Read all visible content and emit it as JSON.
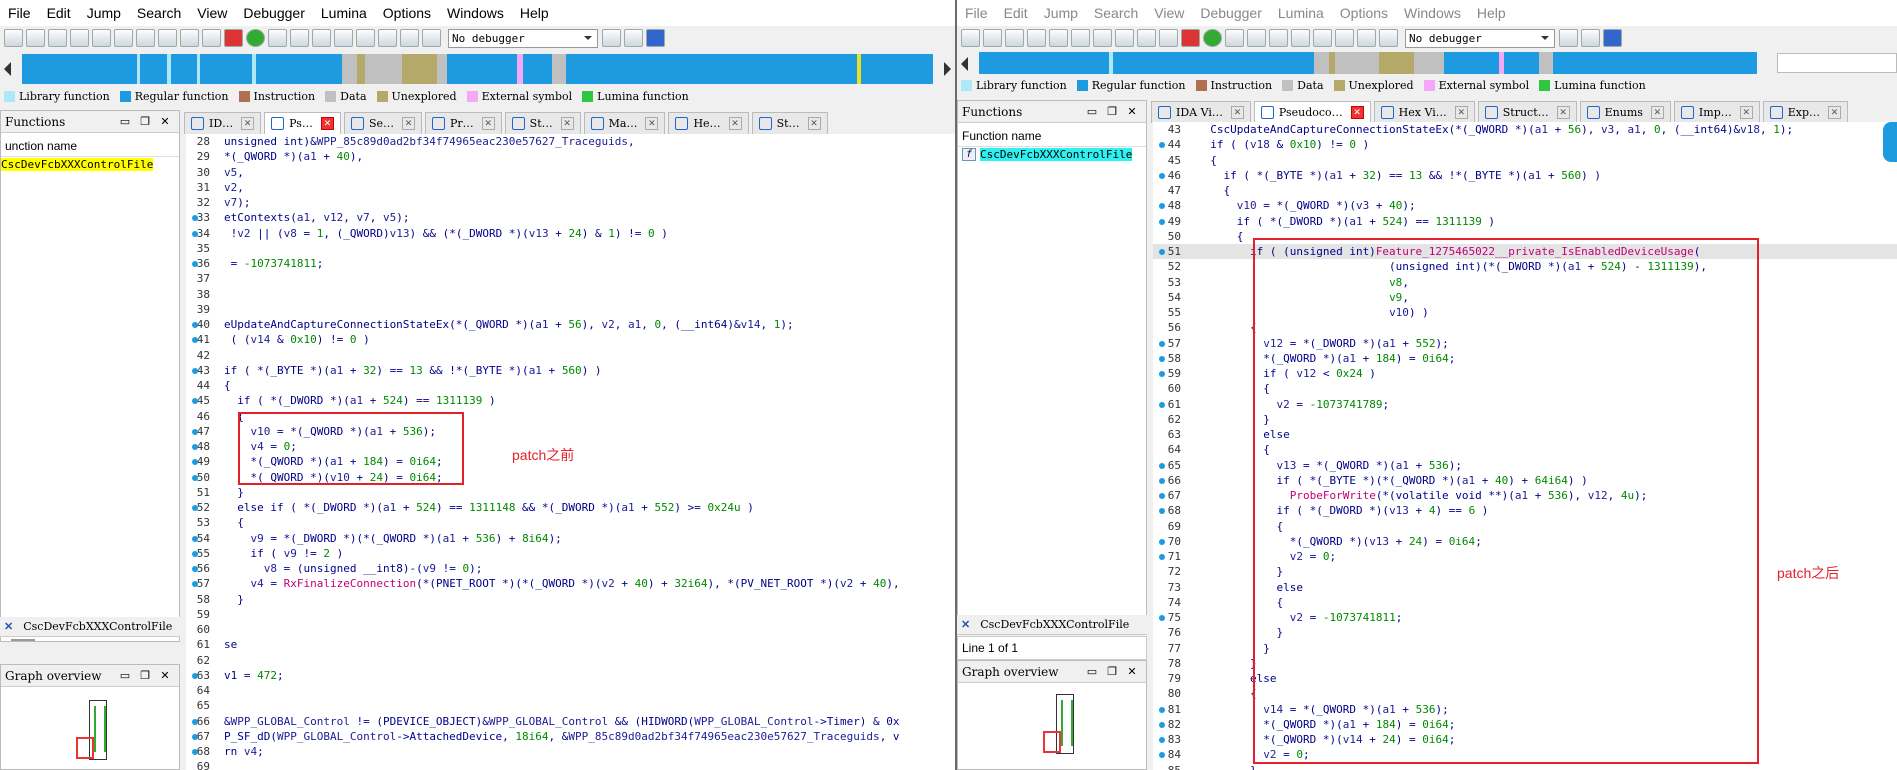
{
  "menu": [
    "File",
    "Edit",
    "Jump",
    "Search",
    "View",
    "Debugger",
    "Lumina",
    "Options",
    "Windows",
    "Help"
  ],
  "toolbar": {
    "debugger": "No debugger"
  },
  "legend": [
    {
      "label": "Library function",
      "color": "#aee8f6"
    },
    {
      "label": "Regular function",
      "color": "#1e9be0"
    },
    {
      "label": "Instruction",
      "color": "#b07050"
    },
    {
      "label": "Data",
      "color": "#c0c0c0"
    },
    {
      "label": "Unexplored",
      "color": "#b5a96a"
    },
    {
      "label": "External symbol",
      "color": "#f5a8f5"
    },
    {
      "label": "Lumina function",
      "color": "#2fc742"
    }
  ],
  "left": {
    "tabs": [
      "ID…",
      "Ps…",
      "Se…",
      "Pr…",
      "St…",
      "Ma…",
      "He…",
      "St…"
    ],
    "functions_panel": {
      "title": "Functions",
      "column": "unction name",
      "items": [
        "CscDevFcbXXXControlFile"
      ]
    },
    "file_tab": "CscDevFcbXXXControlFile",
    "graph_title": "Graph overview",
    "note": "patch之前",
    "lines": [
      {
        "n": "28",
        "d": false,
        "h": "unsigned int)&<span class=\"v\">WPP_85c89d0ad2bf34f74965eac230e57627_Traceguids</span>,"
      },
      {
        "n": "29",
        "d": false,
        "h": "*(_QWORD *)(<span class=\"v\">a1</span> + <span class=\"n\">40</span>),"
      },
      {
        "n": "30",
        "d": false,
        "h": "<span class=\"v\">v5</span>,"
      },
      {
        "n": "31",
        "d": false,
        "h": "<span class=\"v\">v2</span>,"
      },
      {
        "n": "32",
        "d": false,
        "h": "<span class=\"v\">v7</span>);"
      },
      {
        "n": "33",
        "d": true,
        "h": "etContexts(<span class=\"v\">a1</span>, <span class=\"v\">v12</span>, <span class=\"v\">v7</span>, <span class=\"v\">v5</span>);"
      },
      {
        "n": "34",
        "d": true,
        "h": " !<span class=\"v\">v2</span> || (<span class=\"v\">v8</span> = <span class=\"n\">1</span>, (_QWORD)<span class=\"v\">v13</span>) &amp;&amp; (*(_DWORD *)(<span class=\"v\">v13</span> + <span class=\"n\">24</span>) &amp; <span class=\"n\">1</span>) != <span class=\"n\">0</span> )"
      },
      {
        "n": "35",
        "d": false,
        "h": ""
      },
      {
        "n": "36",
        "d": true,
        "h": " = <span class=\"n\">-1073741811</span>;"
      },
      {
        "n": "37",
        "d": false,
        "h": ""
      },
      {
        "n": "38",
        "d": false,
        "h": ""
      },
      {
        "n": "39",
        "d": false,
        "h": ""
      },
      {
        "n": "40",
        "d": true,
        "h": "eUpdateAndCaptureConnectionStateEx(*(_QWORD *)(<span class=\"v\">a1</span> + <span class=\"n\">56</span>), <span class=\"v\">v2</span>, <span class=\"v\">a1</span>, <span class=\"n\">0</span>, (__int64)&amp;<span class=\"v\">v14</span>, <span class=\"n\">1</span>);"
      },
      {
        "n": "41",
        "d": true,
        "h": " ( (<span class=\"v\">v14</span> &amp; <span class=\"n\">0x10</span>) != <span class=\"n\">0</span> )"
      },
      {
        "n": "42",
        "d": false,
        "h": ""
      },
      {
        "n": "43",
        "d": true,
        "h": "if ( *(_BYTE *)(<span class=\"v\">a1</span> + <span class=\"n\">32</span>) == <span class=\"n\">13</span> &amp;&amp; !*(_BYTE *)(<span class=\"v\">a1</span> + <span class=\"n\">560</span>) )"
      },
      {
        "n": "44",
        "d": false,
        "h": "{"
      },
      {
        "n": "45",
        "d": true,
        "h": "  if ( *(_DWORD *)(<span class=\"v\">a1</span> + <span class=\"n\">524</span>) == <span class=\"n\">1311139</span> )"
      },
      {
        "n": "46",
        "d": false,
        "h": "  {"
      },
      {
        "n": "47",
        "d": true,
        "h": "    <span class=\"v\">v10</span> = *(_QWORD *)(<span class=\"v\">a1</span> + <span class=\"n\">536</span>);"
      },
      {
        "n": "48",
        "d": true,
        "h": "    <span class=\"v\">v4</span> = <span class=\"n\">0</span>;"
      },
      {
        "n": "49",
        "d": true,
        "h": "    *(_QWORD *)(<span class=\"v\">a1</span> + <span class=\"n\">184</span>) = <span class=\"n\">0i64</span>;"
      },
      {
        "n": "50",
        "d": true,
        "h": "    *(_QWORD *)(<span class=\"v\">v10</span> + <span class=\"n\">24</span>) = <span class=\"n\">0i64</span>;"
      },
      {
        "n": "51",
        "d": false,
        "h": "  }"
      },
      {
        "n": "52",
        "d": true,
        "h": "  else if ( *(_DWORD *)(<span class=\"v\">a1</span> + <span class=\"n\">524</span>) == <span class=\"n\">1311148</span> &amp;&amp; *(_DWORD *)(<span class=\"v\">a1</span> + <span class=\"n\">552</span>) &gt;= <span class=\"n\">0x24u</span> )"
      },
      {
        "n": "53",
        "d": false,
        "h": "  {"
      },
      {
        "n": "54",
        "d": true,
        "h": "    <span class=\"v\">v9</span> = *(_DWORD *)(*(_QWORD *)(<span class=\"v\">a1</span> + <span class=\"n\">536</span>) + <span class=\"n\">8i64</span>);"
      },
      {
        "n": "55",
        "d": true,
        "h": "    if ( <span class=\"v\">v9</span> != <span class=\"n\">2</span> )"
      },
      {
        "n": "56",
        "d": true,
        "h": "      <span class=\"v\">v8</span> = (unsigned __int8)-(<span class=\"v\">v9</span> != <span class=\"n\">0</span>);"
      },
      {
        "n": "57",
        "d": true,
        "h": "    <span class=\"v\">v4</span> = <span class=\"f\">RxFinalizeConnection</span>(*(PNET_ROOT *)(*(_QWORD *)(<span class=\"v\">v2</span> + <span class=\"n\">40</span>) + <span class=\"n\">32i64</span>), *(PV_NET_ROOT *)(<span class=\"v\">v2</span> + <span class=\"n\">40</span>),"
      },
      {
        "n": "58",
        "d": false,
        "h": "  }"
      },
      {
        "n": "59",
        "d": false,
        "h": ""
      },
      {
        "n": "60",
        "d": false,
        "h": ""
      },
      {
        "n": "61",
        "d": false,
        "h": "se"
      },
      {
        "n": "62",
        "d": false,
        "h": ""
      },
      {
        "n": "63",
        "d": true,
        "h": "v1 = <span class=\"n\">472</span>;"
      },
      {
        "n": "64",
        "d": false,
        "h": ""
      },
      {
        "n": "65",
        "d": false,
        "h": ""
      },
      {
        "n": "66",
        "d": true,
        "h": "&amp;<span class=\"v\">WPP_GLOBAL_Control</span> != (PDEVICE_OBJECT)&amp;<span class=\"v\">WPP_GLOBAL_Control</span> &amp;&amp; (HIDWORD(<span class=\"v\">WPP_GLOBAL_Control</span>-&gt;Timer) &amp; 0x"
      },
      {
        "n": "67",
        "d": true,
        "h": "P_SF_dD(<span class=\"v\">WPP_GLOBAL_Control</span>-&gt;AttachedDevice, <span class=\"n\">18i64</span>, &amp;<span class=\"v\">WPP_85c89d0ad2bf34f74965eac230e57627_Traceguids</span>, v"
      },
      {
        "n": "68",
        "d": true,
        "h": "rn <span class=\"v\">v4</span>;"
      },
      {
        "n": "69",
        "d": false,
        "h": ""
      }
    ]
  },
  "right": {
    "tabs": [
      "IDA Vi…",
      "Pseudoco…",
      "Hex Vi…",
      "Struct…",
      "Enums",
      "Imp…",
      "Exp…"
    ],
    "functions_panel": {
      "title": "Functions",
      "column": "Function name",
      "items": [
        "CscDevFcbXXXControlFile"
      ]
    },
    "file_tab": "CscDevFcbXXXControlFile",
    "line_status": "Line 1 of 1",
    "graph_title": "Graph overview",
    "note": "patch之后",
    "lines": [
      {
        "n": "43",
        "d": false,
        "h": "  CscUpdateAndCaptureConnectionStateEx(*(_QWORD *)(<span class=\"v\">a1</span> + <span class=\"n\">56</span>), <span class=\"v\">v3</span>, <span class=\"v\">a1</span>, <span class=\"n\">0</span>, (__int64)&amp;<span class=\"v\">v18</span>, <span class=\"n\">1</span>);"
      },
      {
        "n": "44",
        "d": true,
        "h": "  if ( (<span class=\"v\">v18</span> &amp; <span class=\"n\">0x10</span>) != <span class=\"n\">0</span> )"
      },
      {
        "n": "45",
        "d": false,
        "h": "  {"
      },
      {
        "n": "46",
        "d": true,
        "h": "    if ( *(_BYTE *)(<span class=\"v\">a1</span> + <span class=\"n\">32</span>) == <span class=\"n\">13</span> &amp;&amp; !*(_BYTE *)(<span class=\"v\">a1</span> + <span class=\"n\">560</span>) )"
      },
      {
        "n": "47",
        "d": false,
        "h": "    {"
      },
      {
        "n": "48",
        "d": true,
        "h": "      <span class=\"v\">v10</span> = *(_QWORD *)(<span class=\"v\">v3</span> + <span class=\"n\">40</span>);"
      },
      {
        "n": "49",
        "d": true,
        "h": "      if ( *(_DWORD *)(<span class=\"v\">a1</span> + <span class=\"n\">524</span>) == <span class=\"n\">1311139</span> )"
      },
      {
        "n": "50",
        "d": false,
        "h": "      {"
      },
      {
        "n": "51",
        "d": true,
        "hl": true,
        "h": "        if ( (unsigned int)<span class=\"g\">Feature_1275465022__private_IsEnabledDeviceUsage</span>("
      },
      {
        "n": "52",
        "d": false,
        "h": "                             (unsigned int)(*(_DWORD *)(<span class=\"v\">a1</span> + <span class=\"n\">524</span>) - <span class=\"n\">1311139</span>),"
      },
      {
        "n": "53",
        "d": false,
        "h": "                             <span class=\"n\">v8</span>,"
      },
      {
        "n": "54",
        "d": false,
        "h": "                             <span class=\"n\">v9</span>,"
      },
      {
        "n": "55",
        "d": false,
        "h": "                             <span class=\"v\">v10</span>) )"
      },
      {
        "n": "56",
        "d": false,
        "h": "        {"
      },
      {
        "n": "57",
        "d": true,
        "h": "          <span class=\"v\">v12</span> = *(_DWORD *)(<span class=\"v\">a1</span> + <span class=\"n\">552</span>);"
      },
      {
        "n": "58",
        "d": true,
        "h": "          *(_QWORD *)(<span class=\"v\">a1</span> + <span class=\"n\">184</span>) = <span class=\"n\">0i64</span>;"
      },
      {
        "n": "59",
        "d": true,
        "h": "          if ( <span class=\"v\">v12</span> &lt; <span class=\"n\">0x24</span> )"
      },
      {
        "n": "60",
        "d": false,
        "h": "          {"
      },
      {
        "n": "61",
        "d": true,
        "h": "            <span class=\"v\">v2</span> = <span class=\"n\">-1073741789</span>;"
      },
      {
        "n": "62",
        "d": false,
        "h": "          }"
      },
      {
        "n": "63",
        "d": false,
        "h": "          else"
      },
      {
        "n": "64",
        "d": false,
        "h": "          {"
      },
      {
        "n": "65",
        "d": true,
        "h": "            <span class=\"v\">v13</span> = *(_QWORD *)(<span class=\"v\">a1</span> + <span class=\"n\">536</span>);"
      },
      {
        "n": "66",
        "d": true,
        "h": "            if ( *(_BYTE *)(*(_QWORD *)(<span class=\"v\">a1</span> + <span class=\"n\">40</span>) + <span class=\"n\">64i64</span>) )"
      },
      {
        "n": "67",
        "d": true,
        "h": "              <span class=\"f\">ProbeForWrite</span>(*(volatile void **)(<span class=\"v\">a1</span> + <span class=\"n\">536</span>), <span class=\"v\">v12</span>, <span class=\"n\">4u</span>);"
      },
      {
        "n": "68",
        "d": true,
        "h": "            if ( *(_DWORD *)(<span class=\"v\">v13</span> + <span class=\"n\">4</span>) == <span class=\"n\">6</span> )"
      },
      {
        "n": "69",
        "d": false,
        "h": "            {"
      },
      {
        "n": "70",
        "d": true,
        "h": "              *(_QWORD *)(<span class=\"v\">v13</span> + <span class=\"n\">24</span>) = <span class=\"n\">0i64</span>;"
      },
      {
        "n": "71",
        "d": true,
        "h": "              <span class=\"v\">v2</span> = <span class=\"n\">0</span>;"
      },
      {
        "n": "72",
        "d": false,
        "h": "            }"
      },
      {
        "n": "73",
        "d": false,
        "h": "            else"
      },
      {
        "n": "74",
        "d": false,
        "h": "            {"
      },
      {
        "n": "75",
        "d": true,
        "h": "              <span class=\"v\">v2</span> = <span class=\"n\">-1073741811</span>;"
      },
      {
        "n": "76",
        "d": false,
        "h": "            }"
      },
      {
        "n": "77",
        "d": false,
        "h": "          }"
      },
      {
        "n": "78",
        "d": false,
        "h": "        }"
      },
      {
        "n": "79",
        "d": false,
        "h": "        else"
      },
      {
        "n": "80",
        "d": false,
        "h": "        {"
      },
      {
        "n": "81",
        "d": true,
        "h": "          <span class=\"v\">v14</span> = *(_QWORD *)(<span class=\"v\">a1</span> + <span class=\"n\">536</span>);"
      },
      {
        "n": "82",
        "d": true,
        "h": "          *(_QWORD *)(<span class=\"v\">a1</span> + <span class=\"n\">184</span>) = <span class=\"n\">0i64</span>;"
      },
      {
        "n": "83",
        "d": true,
        "h": "          *(_QWORD *)(<span class=\"v\">v14</span> + <span class=\"n\">24</span>) = <span class=\"n\">0i64</span>;"
      },
      {
        "n": "84",
        "d": true,
        "h": "          <span class=\"v\">v2</span> = <span class=\"n\">0</span>;"
      },
      {
        "n": "85",
        "d": false,
        "h": "        }"
      }
    ]
  }
}
